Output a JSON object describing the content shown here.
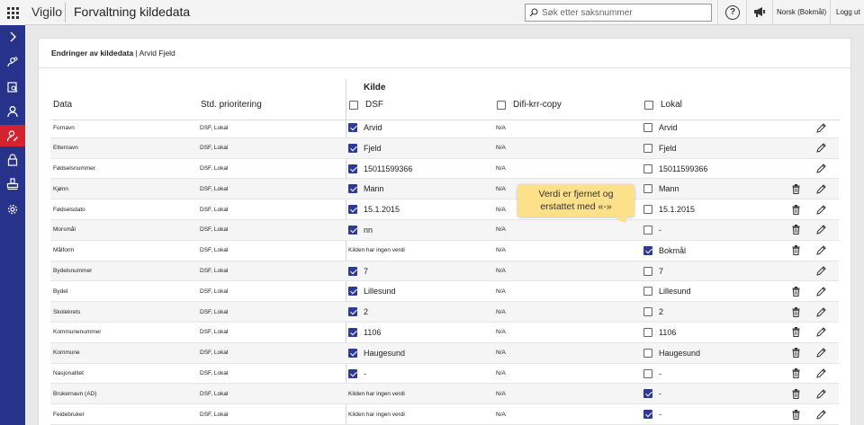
{
  "app": {
    "name": "Vigilo",
    "page_title": "Forvaltning kildedata"
  },
  "topbar": {
    "search_placeholder": "Søk etter saksnummer",
    "help_label": "?",
    "language": "Norsk (Bokmål)",
    "logout": "Logg ut"
  },
  "sidebar": {
    "items": [
      {
        "icon": "chevron-right-icon"
      },
      {
        "icon": "users-search-icon"
      },
      {
        "icon": "document-search-icon"
      },
      {
        "icon": "user-icon"
      },
      {
        "icon": "user-edit-icon",
        "active": true
      },
      {
        "icon": "lock-icon"
      },
      {
        "icon": "stamp-icon"
      },
      {
        "icon": "gear-icon"
      }
    ]
  },
  "panel": {
    "title_bold": "Endringer av kildedata",
    "title_rest": " | Arvid Fjeld"
  },
  "table": {
    "group_label": "Kilde",
    "headers": {
      "data": "Data",
      "priority": "Std. prioritering",
      "dsf": "DSF",
      "difi": "Difi-krr-copy",
      "lokal": "Lokal"
    },
    "rows": [
      {
        "name": "Fornavn",
        "prio": "DSF, Lokal",
        "dsf": "Arvid",
        "dsf_checked": true,
        "difi": "N/A",
        "lokal": "Arvid",
        "lokal_checked": false,
        "delete": false
      },
      {
        "name": "Etternavn",
        "prio": "DSF, Lokal",
        "dsf": "Fjeld",
        "dsf_checked": true,
        "difi": "N/A",
        "lokal": "Fjeld",
        "lokal_checked": false,
        "delete": false
      },
      {
        "name": "Fødselsnummer",
        "prio": "DSF, Lokal",
        "dsf": "15011599366",
        "dsf_checked": true,
        "difi": "N/A",
        "lokal": "15011599366",
        "lokal_checked": false,
        "delete": false
      },
      {
        "name": "Kjønn",
        "prio": "DSF, Lokal",
        "dsf": "Mann",
        "dsf_checked": true,
        "difi": "N/A",
        "lokal": "Mann",
        "lokal_checked": false,
        "delete": true
      },
      {
        "name": "Fødselsdato",
        "prio": "DSF, Lokal",
        "dsf": "15.1.2015",
        "dsf_checked": true,
        "difi": "N/A",
        "lokal": "15.1.2015",
        "lokal_checked": false,
        "delete": true
      },
      {
        "name": "Morsmål",
        "prio": "DSF, Lokal",
        "dsf": "nn",
        "dsf_checked": true,
        "difi": "N/A",
        "lokal": "-",
        "lokal_checked": false,
        "delete": true
      },
      {
        "name": "Målform",
        "prio": "DSF, Lokal",
        "dsf": "Kilden har ingen verdi",
        "dsf_checked": null,
        "difi": "N/A",
        "lokal": "Bokmål",
        "lokal_checked": true,
        "delete": true
      },
      {
        "name": "Bydelsnummer",
        "prio": "DSF, Lokal",
        "dsf": "7",
        "dsf_checked": true,
        "difi": "N/A",
        "lokal": "7",
        "lokal_checked": false,
        "delete": false
      },
      {
        "name": "Bydel",
        "prio": "DSF, Lokal",
        "dsf": "Lillesund",
        "dsf_checked": true,
        "difi": "N/A",
        "lokal": "Lillesund",
        "lokal_checked": false,
        "delete": true
      },
      {
        "name": "Skolekrets",
        "prio": "DSF, Lokal",
        "dsf": "2",
        "dsf_checked": true,
        "difi": "N/A",
        "lokal": "2",
        "lokal_checked": false,
        "delete": true
      },
      {
        "name": "Kommunenummer",
        "prio": "DSF, Lokal",
        "dsf": "1106",
        "dsf_checked": true,
        "difi": "N/A",
        "lokal": "1106",
        "lokal_checked": false,
        "delete": true
      },
      {
        "name": "Kommune",
        "prio": "DSF, Lokal",
        "dsf": "Haugesund",
        "dsf_checked": true,
        "difi": "N/A",
        "lokal": "Haugesund",
        "lokal_checked": false,
        "delete": true
      },
      {
        "name": "Nasjonalitet",
        "prio": "DSF, Lokal",
        "dsf": "-",
        "dsf_checked": true,
        "difi": "N/A",
        "lokal": "-",
        "lokal_checked": false,
        "delete": true
      },
      {
        "name": "Brukernavn (AD)",
        "prio": "DSF, Lokal",
        "dsf": "Kilden har ingen verdi",
        "dsf_checked": null,
        "difi": "N/A",
        "lokal": "-",
        "lokal_checked": true,
        "delete": true
      },
      {
        "name": "Feidebruker",
        "prio": "DSF, Lokal",
        "dsf": "Kilden har ingen verdi",
        "dsf_checked": null,
        "difi": "N/A",
        "lokal": "-",
        "lokal_checked": true,
        "delete": true
      }
    ]
  },
  "callout": {
    "line1": "Verdi er fjernet og",
    "line2": "erstattet med «-»"
  },
  "colors": {
    "sidebar": "#27338a",
    "active": "#d2232e",
    "checkbox": "#2d3a96",
    "callout": "#fde08a"
  }
}
